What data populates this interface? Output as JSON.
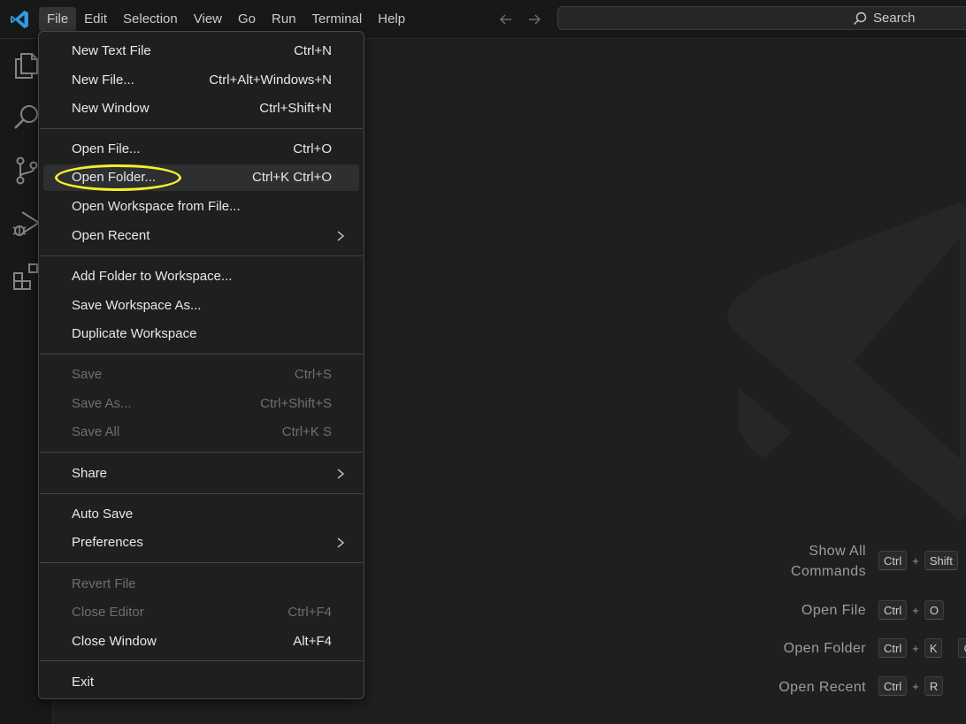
{
  "menubar": {
    "items": [
      "File",
      "Edit",
      "Selection",
      "View",
      "Go",
      "Run",
      "Terminal",
      "Help"
    ],
    "active": "File"
  },
  "search": {
    "label": "Search"
  },
  "file_menu": {
    "items": [
      {
        "label": "New Text File",
        "shortcut": "Ctrl+N"
      },
      {
        "label": "New File...",
        "shortcut": "Ctrl+Alt+Windows+N"
      },
      {
        "label": "New Window",
        "shortcut": "Ctrl+Shift+N"
      },
      {
        "label": "Open File...",
        "shortcut": "Ctrl+O"
      },
      {
        "label": "Open Folder...",
        "shortcut": "Ctrl+K Ctrl+O"
      },
      {
        "label": "Open Workspace from File...",
        "shortcut": ""
      },
      {
        "label": "Open Recent",
        "shortcut": ""
      },
      {
        "label": "Add Folder to Workspace...",
        "shortcut": ""
      },
      {
        "label": "Save Workspace As...",
        "shortcut": ""
      },
      {
        "label": "Duplicate Workspace",
        "shortcut": ""
      },
      {
        "label": "Save",
        "shortcut": "Ctrl+S"
      },
      {
        "label": "Save As...",
        "shortcut": "Ctrl+Shift+S"
      },
      {
        "label": "Save All",
        "shortcut": "Ctrl+K S"
      },
      {
        "label": "Share",
        "shortcut": ""
      },
      {
        "label": "Auto Save",
        "shortcut": ""
      },
      {
        "label": "Preferences",
        "shortcut": ""
      },
      {
        "label": "Revert File",
        "shortcut": ""
      },
      {
        "label": "Close Editor",
        "shortcut": "Ctrl+F4"
      },
      {
        "label": "Close Window",
        "shortcut": "Alt+F4"
      },
      {
        "label": "Exit",
        "shortcut": ""
      }
    ]
  },
  "welcome_hints": [
    {
      "label": "Show All Commands",
      "line1": "Show All",
      "line2": "Commands",
      "keys": [
        "Ctrl",
        "Shift"
      ]
    },
    {
      "label": "Open File",
      "keys": [
        "Ctrl",
        "O"
      ]
    },
    {
      "label": "Open Folder",
      "keys": [
        "Ctrl",
        "K",
        "C"
      ]
    },
    {
      "label": "Open Recent",
      "keys": [
        "Ctrl",
        "R"
      ]
    }
  ],
  "colors": {
    "highlight_ring": "#f7ef2a",
    "vscode_blue": "#2f9ae8",
    "background": "#1f1f1f"
  }
}
